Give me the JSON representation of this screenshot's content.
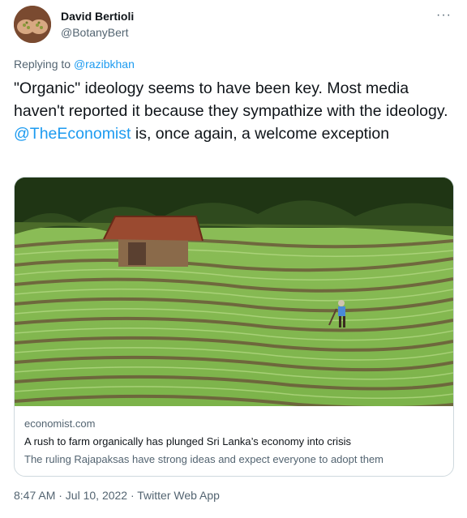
{
  "author": {
    "name": "David Bertioli",
    "handle": "@BotanyBert",
    "avatar_icon": "hands-with-seeds-avatar"
  },
  "more_icon": "···",
  "reply": {
    "prefix": "Replying to",
    "to": "@razibkhan"
  },
  "tweet": {
    "text_before": "\"Organic\" ideology seems to have been key. Most media haven't reported it because they sympathize with the ideology.",
    "mention": "@TheEconomist",
    "text_after": "is, once again, a welcome exception"
  },
  "card": {
    "domain": "economist.com",
    "title": "A rush to farm organically has plunged Sri Lanka’s economy into crisis",
    "description": "The ruling Rajapaksas have strong ideas and expect everyone to adopt them",
    "image_subject": "terraced-rice-field-with-hut-and-farmer"
  },
  "meta": {
    "time": "8:47 AM",
    "date": "Jul 10, 2022",
    "source": "Twitter Web App",
    "line": "8:47 AM · Jul 10, 2022 · Twitter Web App"
  },
  "colors": {
    "link": "#1d9bf0",
    "secondary": "#536471",
    "text": "#0f1419",
    "border": "#cfd9de"
  }
}
